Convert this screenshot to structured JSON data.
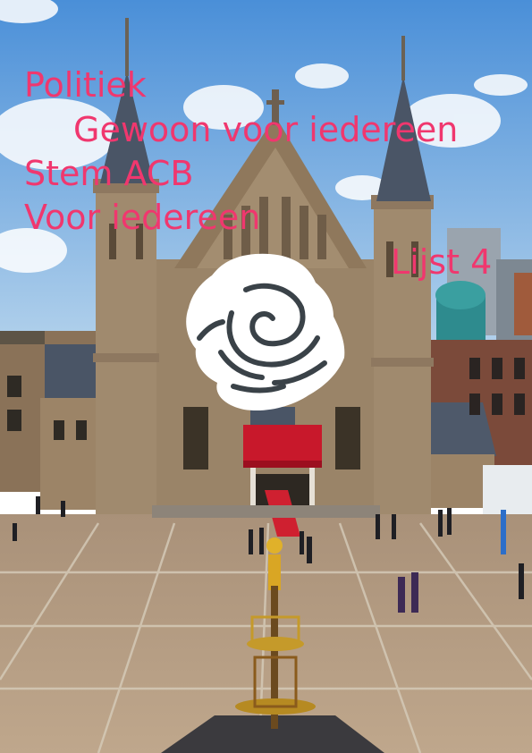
{
  "poster": {
    "headlines": [
      "Politiek",
      "Gewoon voor iedereen",
      "Stem ACB",
      "Voor iedereen",
      "Lijst 4"
    ]
  },
  "colors": {
    "headline": "#f0376e",
    "sky_top": "#4a8fd8",
    "sky_bottom": "#a9cdea",
    "brick": "#9a8468",
    "brick_dark": "#7d6a52",
    "roof": "#4f5a6b",
    "canopy": "#c8182b",
    "carpet": "#cf2030",
    "square": "#b49d84",
    "square_line": "#d8cfc0",
    "rose": "#ffffff"
  },
  "icons": {
    "rose": "rose-icon",
    "fountain": "fountain-statue-icon"
  }
}
